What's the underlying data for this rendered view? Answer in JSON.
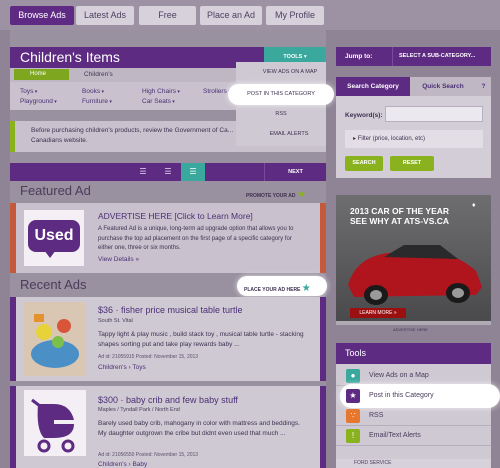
{
  "topnav": {
    "tabs": [
      {
        "label": "Browse Ads",
        "active": true
      },
      {
        "label": "Latest Ads",
        "active": false
      },
      {
        "label": "Free",
        "active": false
      },
      {
        "label": "Place an Ad",
        "active": false
      },
      {
        "label": "My Profile",
        "active": false
      }
    ]
  },
  "section": {
    "title": "Children's Items",
    "tools_label": "TOOLS"
  },
  "breadcrumb": {
    "home": "Home",
    "current": "Children's"
  },
  "categories": [
    "Toys",
    "Books",
    "High Chairs",
    "Strollers",
    "Playground",
    "Furniture",
    "Car Seats"
  ],
  "tools_menu": {
    "items": [
      "VIEW ADS ON A MAP",
      "POST IN THIS CATEGORY",
      "RSS",
      "EMAIL ALERTS"
    ]
  },
  "notice": {
    "text": "Before purchasing children's products, review the Government of Ca... Canadians website."
  },
  "viewbar": {
    "next_label": "NEXT"
  },
  "featured": {
    "heading": "Featured Ad",
    "promote_label": "PROMOTE YOUR AD",
    "logo_text": "Used",
    "title": "ADVERTISE HERE [Click to Learn More]",
    "description": "A Featured Ad is a unique, long-term ad upgrade option that allows you to purchase the top ad placement on the first page of a specific category for either one, three or six months.",
    "link": "View Details »"
  },
  "recent": {
    "heading": "Recent Ads",
    "place_label": "PLACE YOUR AD HERE",
    "listings": [
      {
        "title": "$36 · fisher price musical table turtle",
        "location": "South St. Vital",
        "description": "Tappy light & play music , build stack toy , musical table turtle - stacking shapes sorting put and take play rewards baby ...",
        "meta": "Ad id: 21055915  Posted: November 15, 2013",
        "category": "Children's › Toys"
      },
      {
        "title": "$300 · baby crib and few baby stuff",
        "location": "Maples / Tyndall Park / North End",
        "description": "Barely used baby crib, mahogany in color with mattress and beddings. My daughter outgrown the cribe but didnt even used that much ...",
        "meta": "Ad id: 21056550  Posted: November 15, 2013",
        "category": "Children's › Baby"
      }
    ]
  },
  "jump": {
    "label": "Jump to:",
    "select": "SELECT A SUB-CATEGORY..."
  },
  "search": {
    "tabs": [
      "Search Category",
      "Quick Search"
    ],
    "help": "?",
    "keyword_label": "Keyword(s):",
    "keyword_value": "",
    "filter_label": "Filter (price, location, etc)",
    "search_button": "SEARCH",
    "reset_button": "RESET"
  },
  "ad": {
    "line1": "2013 CAR OF THE YEAR",
    "line2": "SEE WHY AT ATS-VS.CA",
    "cta": "LEARN MORE »",
    "label": "ADVERTISE HERE"
  },
  "tools_panel": {
    "heading": "Tools",
    "items": [
      {
        "label": "View Ads on a Map",
        "icon": "map-pin-icon",
        "color": "#3aa89c"
      },
      {
        "label": "Post in this Category",
        "icon": "star-icon",
        "color": "#5e2b82"
      },
      {
        "label": "RSS",
        "icon": "rss-icon",
        "color": "#e8772e"
      },
      {
        "label": "Email/Text Alerts",
        "icon": "alert-icon",
        "color": "#8ab21f"
      }
    ]
  },
  "footer_ad": {
    "text": "FORD SERVICE"
  },
  "colors": {
    "brand_purple": "#5e2b82",
    "teal": "#3aa89c",
    "green": "#8ab21f",
    "orange_red": "#c5593c"
  }
}
